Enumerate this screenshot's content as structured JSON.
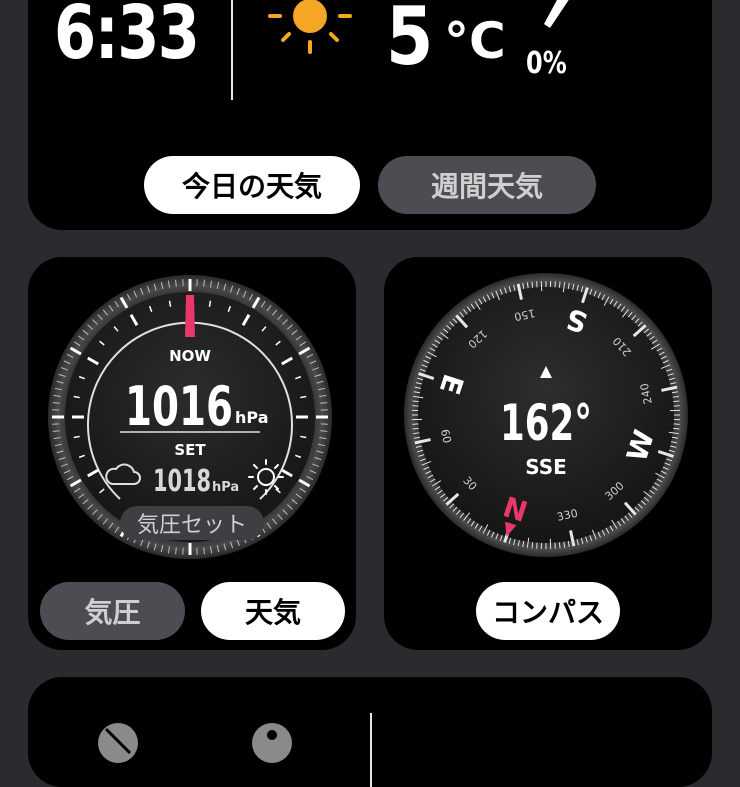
{
  "top_card": {
    "time": "6:33",
    "temperature": "5",
    "temperature_unit": "°C",
    "precipitation": "0%",
    "tabs": [
      {
        "label": "今日の天気",
        "active": true
      },
      {
        "label": "週間天気",
        "active": false
      }
    ]
  },
  "barometer": {
    "now_label": "NOW",
    "pressure": "1016",
    "pressure_unit": "hPa",
    "set_label": "SET",
    "set_pressure": "1018",
    "set_unit": "hPa",
    "set_button": "気圧セット",
    "left_icon": "cloud-icon",
    "right_icon": "sun-icon",
    "tabs": [
      {
        "label": "気圧",
        "active": false
      },
      {
        "label": "天気",
        "active": true
      }
    ]
  },
  "compass": {
    "heading": "162°",
    "direction": "SSE",
    "cardinals": {
      "N": "N",
      "E": "E",
      "S": "S",
      "W": "W"
    },
    "degree_labels": [
      "30",
      "60",
      "120",
      "150",
      "210",
      "240",
      "300",
      "330"
    ],
    "button": "コンパス",
    "needle_color": "#e8386a"
  },
  "colors": {
    "accent": "#e8386a",
    "sun": "#f5a623",
    "card_bg": "#000000",
    "page_bg": "#2a2b2f"
  }
}
